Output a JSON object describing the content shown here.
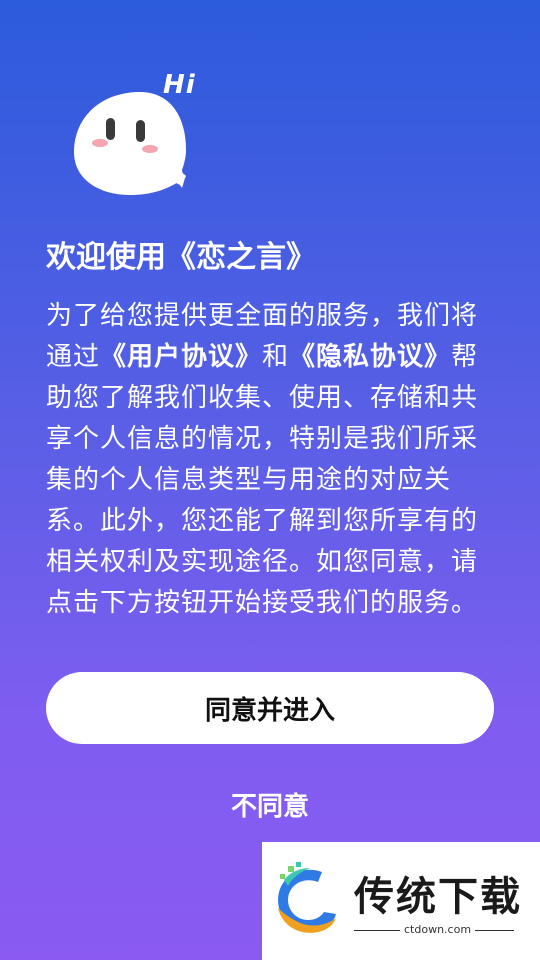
{
  "mascot": {
    "greeting": "Hi"
  },
  "dialog": {
    "title": "欢迎使用《恋之言》",
    "text_parts": {
      "p1": "为了给您提供更全面的服务，我们将通过",
      "user_agreement": "《用户协议》",
      "and": "和",
      "privacy_agreement": "《隐私协议》",
      "p2": "帮助您了解我们收集、使用、存储和共享个人信息的情况，特别是我们所采集的个人信息类型与用途的对应关系。此外，您还能了解到您所享有的相关权利及实现途径。如您同意，请点击下方按钮开始接受我们的服务。"
    },
    "agree_label": "同意并进入",
    "disagree_label": "不同意"
  },
  "watermark": {
    "brand": "传统下载",
    "url": "ctdown.com"
  },
  "colors": {
    "gradient_top": "#2c5bdc",
    "gradient_bottom": "#8a5af2",
    "button_bg": "#ffffff"
  }
}
